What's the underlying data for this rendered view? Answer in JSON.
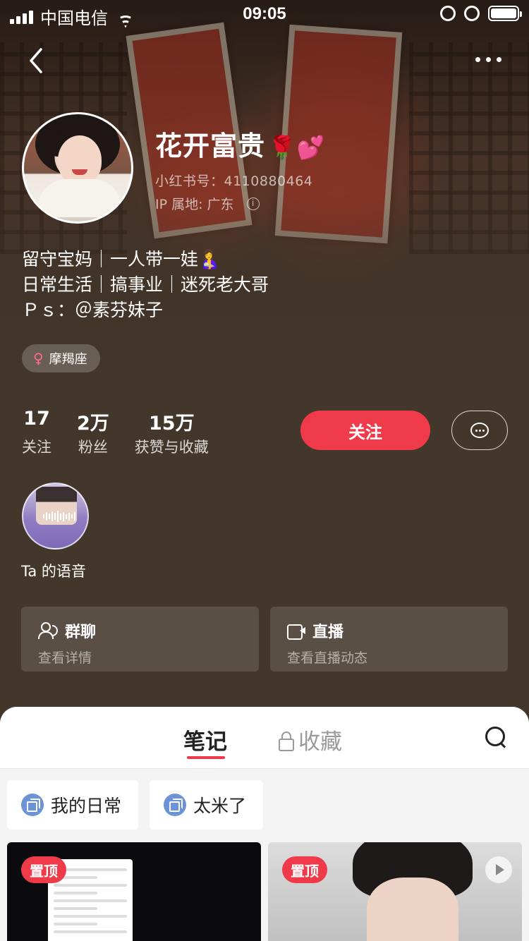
{
  "status_bar": {
    "carrier": "中国电信",
    "time": "09:05"
  },
  "profile": {
    "name": "花开富贵",
    "name_emoji": "🌹💕",
    "red_id": "小红书号：4110880464",
    "ip_location": "IP 属地: 广东",
    "bio": [
      "留守宝妈｜一人带一娃🤱",
      "日常生活｜搞事业｜迷死老大哥",
      "Ｐｓ：＠素芬妹子"
    ],
    "tag": "摩羯座"
  },
  "stats": [
    {
      "num": "17",
      "label": "关注"
    },
    {
      "num": "2万",
      "label": "粉丝"
    },
    {
      "num": "15万",
      "label": "获赞与收藏"
    }
  ],
  "actions": {
    "follow_label": "关注"
  },
  "voice": {
    "label": "Ta 的语音"
  },
  "cards": {
    "group": {
      "title": "群聊",
      "subtitle": "查看详情"
    },
    "live": {
      "title": "直播",
      "subtitle": "查看直播动态"
    }
  },
  "tabs": {
    "notes": "笔记",
    "collect": "收藏"
  },
  "albums": [
    "我的日常",
    "太米了"
  ],
  "notes": [
    {
      "badge": "置顶"
    },
    {
      "badge": "置顶"
    }
  ],
  "colors": {
    "accent": "#ef3a4a",
    "background": "#43372c"
  }
}
